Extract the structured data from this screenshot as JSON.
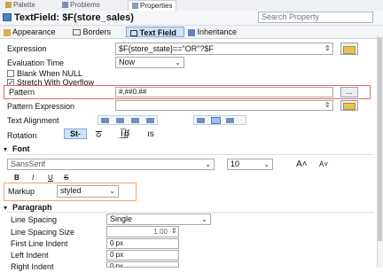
{
  "view_tabs": [
    {
      "label": "Palette",
      "active": false
    },
    {
      "label": "Problems",
      "active": false
    },
    {
      "label": "Properties",
      "active": true
    }
  ],
  "header": {
    "title": "TextField: $F(store_sales)",
    "search_placeholder": "Search Property"
  },
  "prop_tabs": [
    {
      "label": "Appearance",
      "selected": false
    },
    {
      "label": "Borders",
      "selected": false
    },
    {
      "label": "Text Field",
      "selected": true
    },
    {
      "label": "Inheritance",
      "selected": false
    }
  ],
  "fields": {
    "expression_label": "Expression",
    "expression_value": "$F{store_state}==\"OR\"?$F",
    "evaluation_time_label": "Evaluation Time",
    "evaluation_time_value": "Now",
    "blank_when_null_label": "Blank When NULL",
    "stretch_with_overflow_label": "Stretch With Overflow",
    "pattern_label": "Pattern",
    "pattern_value": "#,##0.##",
    "pattern_browse": "...",
    "pattern_expression_label": "Pattern Expression",
    "text_alignment_label": "Text Alignment",
    "rotation_label": "Rotation",
    "rotation_options": [
      "St-",
      "ਠ",
      "\u001b",
      "ıs"
    ]
  },
  "font": {
    "section_label": "Font",
    "family": "SansSerif",
    "size": "10",
    "size_up": "A˄",
    "size_down": "A˅",
    "styles": [
      "B",
      "I",
      "U",
      "S"
    ],
    "markup_label": "Markup",
    "markup_value": "styled"
  },
  "paragraph": {
    "section_label": "Paragraph",
    "line_spacing_label": "Line Spacing",
    "line_spacing_value": "Single",
    "line_spacing_size_label": "Line Spacing Size",
    "line_spacing_size_value": "1.00",
    "first_line_indent_label": "First Line Indent",
    "first_line_indent_value": "0 px",
    "left_indent_label": "Left Indent",
    "left_indent_value": "0 px",
    "right_indent_label": "Right Indent",
    "right_indent_value": "0 px"
  },
  "colors": {
    "highlight_red": "#e36b6b",
    "highlight_orange": "#f0a36a",
    "selected_tab": "#cfe3f8"
  }
}
